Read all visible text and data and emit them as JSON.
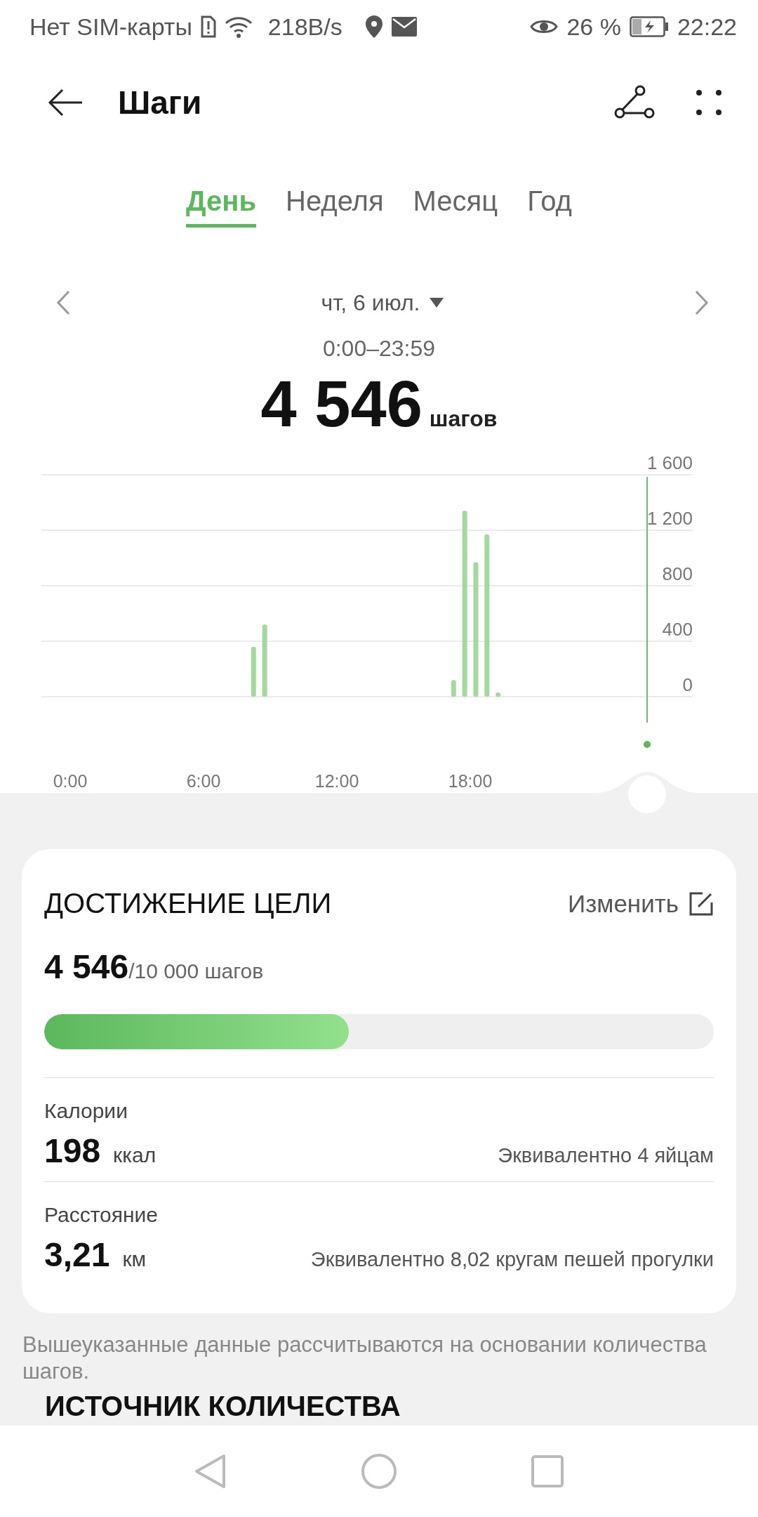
{
  "status_bar": {
    "carrier": "Нет SIM-карты",
    "speed": "218B/s",
    "battery": "26 %",
    "time": "22:22"
  },
  "header": {
    "title": "Шаги"
  },
  "tabs": [
    {
      "label": "День",
      "selected": true
    },
    {
      "label": "Неделя",
      "selected": false
    },
    {
      "label": "Месяц",
      "selected": false
    },
    {
      "label": "Год",
      "selected": false
    }
  ],
  "date": {
    "label": "чт, 6 июл.",
    "range": "0:00–23:59"
  },
  "total": {
    "value": "4 546",
    "unit": "шагов"
  },
  "chart": {
    "chart_data": {
      "type": "bar",
      "grid": true,
      "x": [
        8.25,
        8.75,
        17.25,
        17.75,
        18.25,
        18.75,
        19.25
      ],
      "values": [
        360,
        520,
        120,
        1340,
        970,
        1170,
        30
      ],
      "xlim": [
        -1.3,
        28
      ],
      "ylim": [
        0,
        1600
      ],
      "xticks": [
        {
          "value": 0,
          "label": "0:00"
        },
        {
          "value": 6,
          "label": "6:00"
        },
        {
          "value": 12,
          "label": "12:00"
        },
        {
          "value": 18,
          "label": "18:00"
        }
      ],
      "yticks": [
        {
          "value": 0,
          "label": "0"
        },
        {
          "value": 400,
          "label": "400"
        },
        {
          "value": 800,
          "label": "800"
        },
        {
          "value": 1200,
          "label": "1 200"
        },
        {
          "value": 1600,
          "label": "1 600"
        }
      ]
    }
  },
  "goal": {
    "title": "ДОСТИЖЕНИЕ ЦЕЛИ",
    "edit_label": "Изменить",
    "current": "4 546",
    "target": "/10 000 шагов",
    "level": 0.4546
  },
  "stats": [
    {
      "label": "Калории",
      "value": "198",
      "unit": "ккал",
      "equivalent": "Эквивалентно 4 яйцам"
    },
    {
      "label": "Расстояние",
      "value": "3,21",
      "unit": "км",
      "equivalent": "Эквивалентно 8,02 кругам пешей прогулки"
    }
  ],
  "footnote": "Вышеуказанные данные рассчитываются на основании количества шагов.",
  "next_section": {
    "title": "ИСТОЧНИК КОЛИЧЕСТВА"
  }
}
